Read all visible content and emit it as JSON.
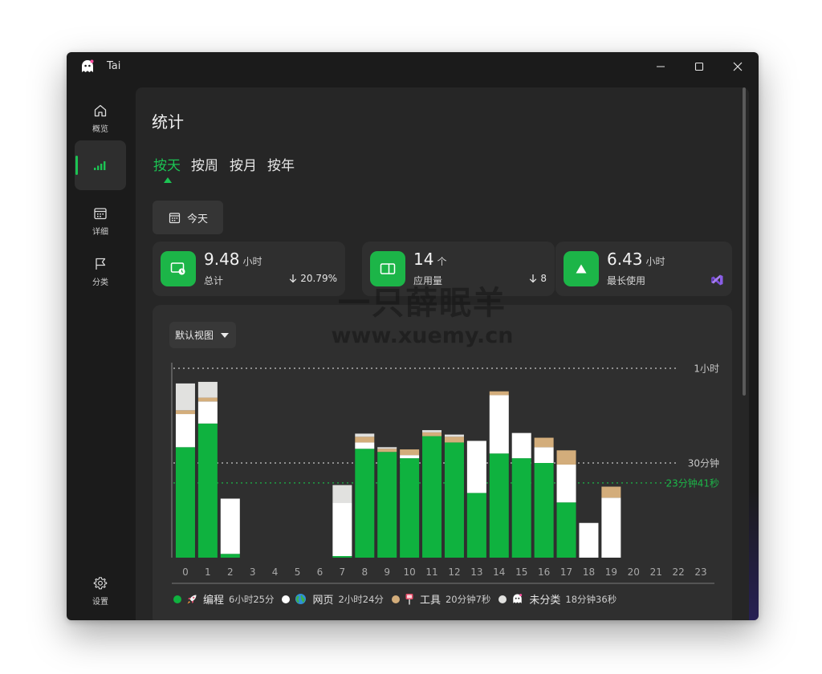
{
  "window": {
    "title": "Tai"
  },
  "sidebar": {
    "items": [
      {
        "label": "概览",
        "icon": "home-icon"
      },
      {
        "label": "",
        "icon": "signal-chart-icon",
        "active": true
      },
      {
        "label": "详细",
        "icon": "calendar-grid-icon"
      },
      {
        "label": "分类",
        "icon": "flag-icon"
      }
    ],
    "settings": {
      "label": "设置",
      "icon": "gear-icon"
    }
  },
  "page": {
    "title": "统计",
    "tabs": [
      "按天",
      "按周",
      "按月",
      "按年"
    ],
    "active_tab": "按天",
    "date_button": {
      "label": "今天",
      "icon": "calendar-icon"
    }
  },
  "stats": [
    {
      "value": "9.48",
      "unit": "小时",
      "label": "总计",
      "extra": "20.79%",
      "extra_icon": "arrow-down-icon",
      "icon": "monitor-clock-icon"
    },
    {
      "value": "14",
      "unit": "个",
      "label": "应用量",
      "extra": "8",
      "extra_icon": "arrow-down-icon",
      "icon": "app-window-icon"
    },
    {
      "value": "6.43",
      "unit": "小时",
      "label": "最长使用",
      "extra": "",
      "extra_icon": "visual-studio-icon",
      "icon": "triangle-up-icon"
    }
  ],
  "chart": {
    "view_select": "默认视图",
    "reference_lines": [
      {
        "label": "1小时",
        "minutes": 60,
        "color": "#c8c8c8"
      },
      {
        "label": "30分钟",
        "minutes": 30,
        "color": "#c8c8c8"
      },
      {
        "label": "23分钟41秒",
        "minutes": 23.68,
        "color": "#1cb548"
      }
    ]
  },
  "chart_data": {
    "type": "bar",
    "stacked": true,
    "xlabel": "",
    "ylabel": "",
    "ylim": [
      0,
      60
    ],
    "categories": [
      "0",
      "1",
      "2",
      "3",
      "4",
      "5",
      "6",
      "7",
      "8",
      "9",
      "10",
      "11",
      "12",
      "13",
      "14",
      "15",
      "16",
      "17",
      "18",
      "19",
      "20",
      "21",
      "22",
      "23"
    ],
    "series": [
      {
        "name": "编程",
        "color": "#0fb23f",
        "values": [
          35,
          42.5,
          1.2,
          0,
          0,
          0,
          0,
          0.5,
          34.5,
          33.5,
          31.5,
          38.5,
          36.5,
          20.5,
          33,
          31.5,
          30,
          17.5,
          0,
          0,
          0,
          0,
          0,
          0
        ]
      },
      {
        "name": "网页",
        "color": "#ffffff",
        "values": [
          10.5,
          7,
          17.5,
          0,
          0,
          0,
          0,
          17,
          2,
          0,
          1,
          0,
          0,
          16.5,
          18.5,
          8,
          5,
          12,
          11,
          19,
          0,
          0,
          0,
          0
        ]
      },
      {
        "name": "工具",
        "color": "#d3ad7b",
        "values": [
          1.2,
          1.2,
          0,
          0,
          0,
          0,
          0,
          0,
          1.8,
          1,
          1.8,
          1.2,
          1.8,
          0,
          1.2,
          0,
          3,
          4.5,
          0,
          3.5,
          0,
          0,
          0,
          0
        ]
      },
      {
        "name": "未分类",
        "color": "#e1e1df",
        "values": [
          8.5,
          5,
          0,
          0,
          0,
          0,
          0,
          5.5,
          1,
          0.5,
          0,
          0.7,
          0.7,
          0,
          0,
          0,
          0,
          0,
          0,
          0,
          0,
          0,
          0,
          0
        ]
      }
    ]
  },
  "legend": [
    {
      "name": "编程",
      "duration": "6小时25分",
      "color": "#0fb23f",
      "icon": "rocket-icon"
    },
    {
      "name": "网页",
      "duration": "2小时24分",
      "color": "#ffffff",
      "icon": "globe-icon"
    },
    {
      "name": "工具",
      "duration": "20分钟7秒",
      "color": "#d3ad7b",
      "icon": "pin-icon"
    },
    {
      "name": "未分类",
      "duration": "18分钟36秒",
      "color": "#e1e1df",
      "icon": "ghost-icon"
    }
  ],
  "watermark": {
    "line1": "一只薛眠羊",
    "line2": "www.xuemy.cn"
  },
  "colors": {
    "accent": "#1cc353",
    "card": "#2f2f2f",
    "background": "#1b1b1b"
  }
}
